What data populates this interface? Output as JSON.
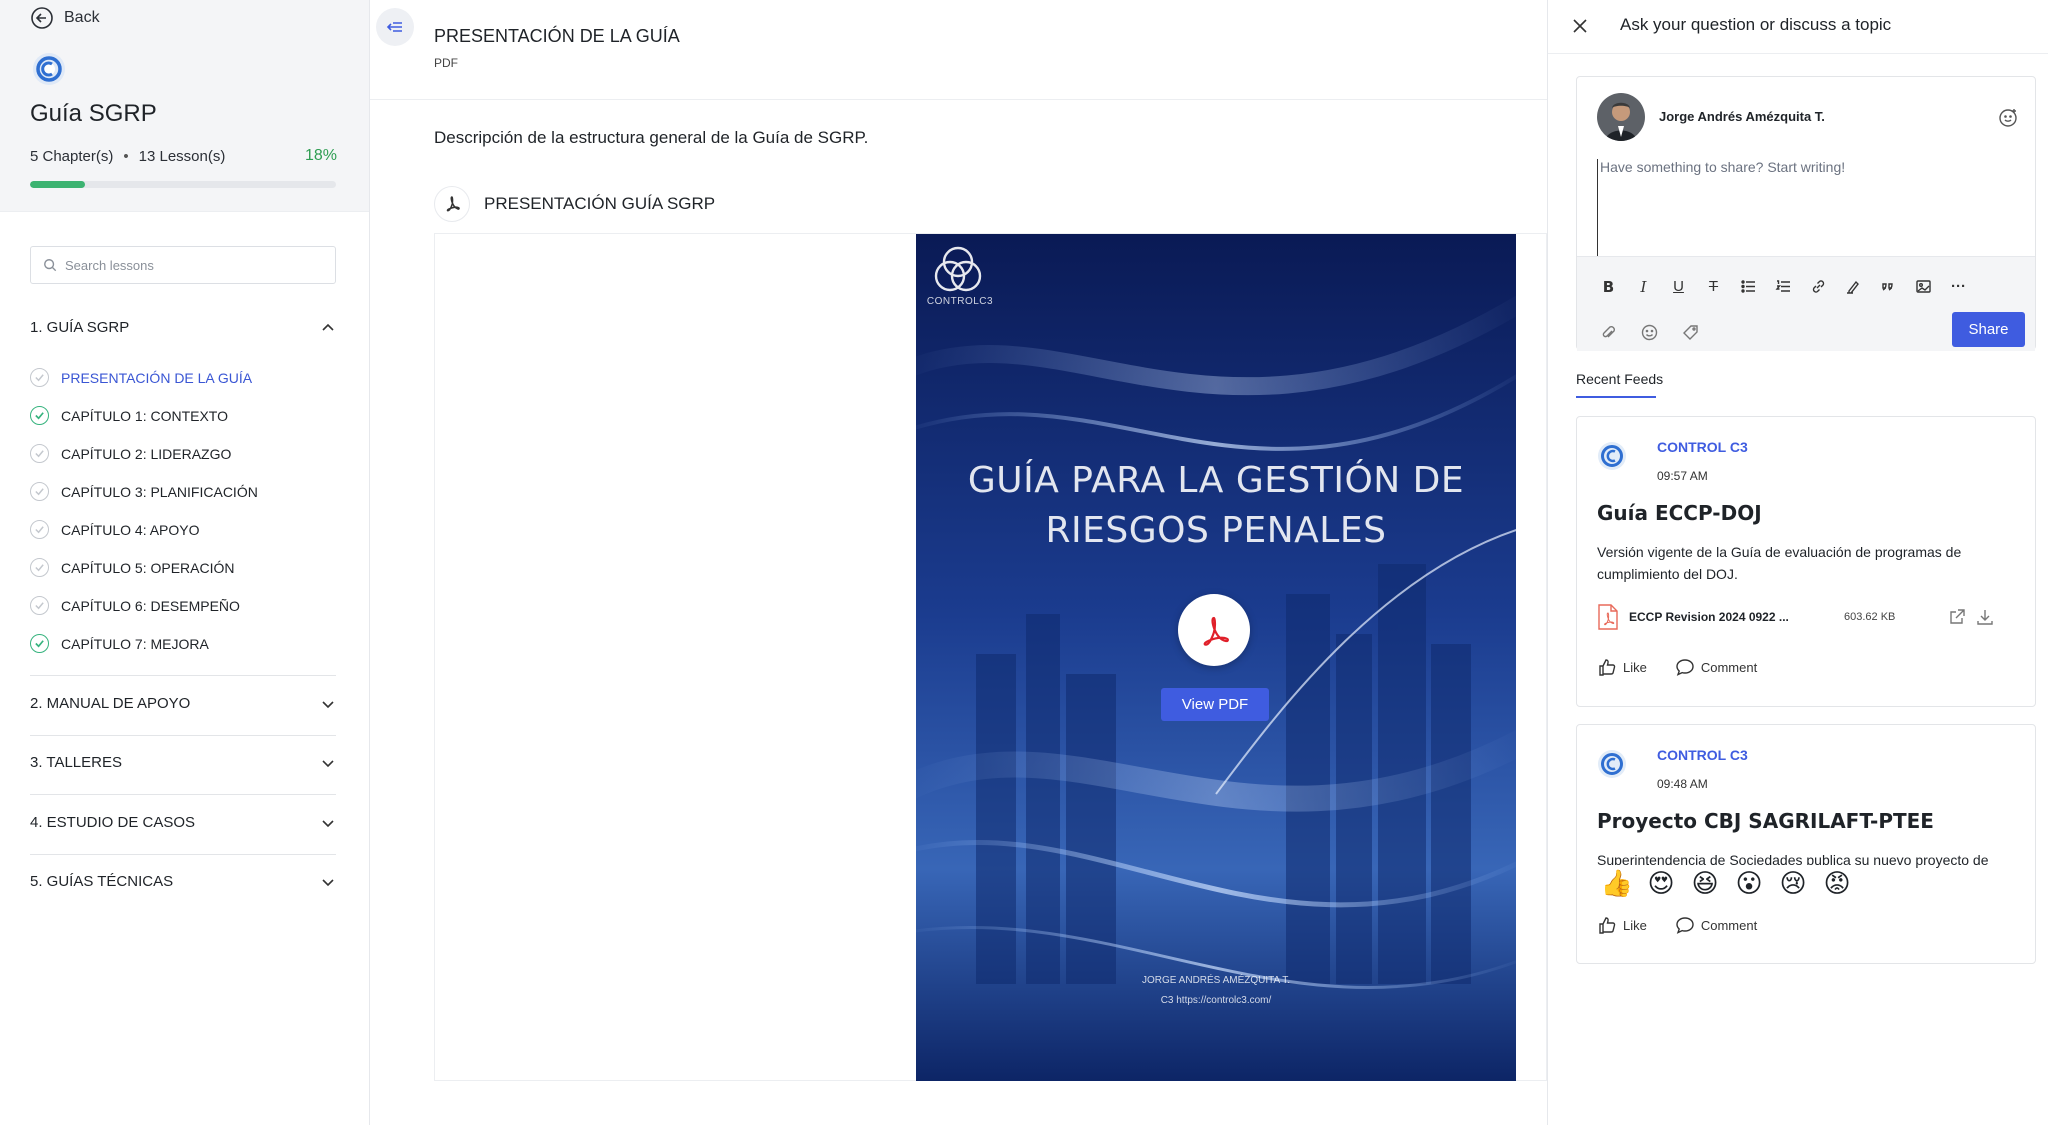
{
  "sidebar": {
    "back_label": "Back",
    "course_title": "Guía SGRP",
    "chapters_count": "5 Chapter(s)",
    "lessons_count": "13 Lesson(s)",
    "progress_percent_label": "18%",
    "progress_fraction": 0.18,
    "search_placeholder": "Search lessons",
    "chapters": [
      {
        "label": "1. GUÍA SGRP",
        "expanded": true
      },
      {
        "label": "2. MANUAL DE APOYO",
        "expanded": false
      },
      {
        "label": "3. TALLERES",
        "expanded": false
      },
      {
        "label": "4. ESTUDIO DE CASOS",
        "expanded": false
      },
      {
        "label": "5. GUÍAS TÉCNICAS",
        "expanded": false
      }
    ],
    "lessons": [
      {
        "label": "PRESENTACIÓN DE LA GUÍA",
        "done": false,
        "active": true
      },
      {
        "label": "CAPÍTULO 1: CONTEXTO",
        "done": true,
        "active": false
      },
      {
        "label": "CAPÍTULO 2: LIDERAZGO",
        "done": false,
        "active": false
      },
      {
        "label": "CAPÍTULO 3: PLANIFICACIÓN",
        "done": false,
        "active": false
      },
      {
        "label": "CAPÍTULO 4: APOYO",
        "done": false,
        "active": false
      },
      {
        "label": "CAPÍTULO 5: OPERACIÓN",
        "done": false,
        "active": false
      },
      {
        "label": "CAPÍTULO 6: DESEMPEÑO",
        "done": false,
        "active": false
      },
      {
        "label": "CAPÍTULO 7: MEJORA",
        "done": true,
        "active": false
      }
    ]
  },
  "main": {
    "lesson_title": "PRESENTACIÓN DE LA GUÍA",
    "lesson_type": "PDF",
    "description": "Descripción de la estructura general de la Guía de SGRP.",
    "attachment_name": "PRESENTACIÓN GUÍA SGRP",
    "cover": {
      "brand": "CONTROLC3",
      "title_line1": "GUÍA PARA LA GESTIÓN DE",
      "title_line2": "RIESGOS PENALES",
      "author": "JORGE ANDRÉS AMÉZQUITA T.",
      "url": "C3  https://controlc3.com/"
    },
    "view_pdf_label": "View PDF"
  },
  "panel": {
    "title": "Ask your question or discuss a topic",
    "composer": {
      "user_name": "Jorge Andrés Amézquita T.",
      "placeholder": "Have something to share? Start writing!",
      "share_label": "Share"
    },
    "feeds_tab": "Recent Feeds",
    "posts": [
      {
        "author": "CONTROL C3",
        "time": "09:57 AM",
        "title": "Guía ECCP-DOJ",
        "body": "Versión vigente de la Guía de evaluación de programas de cumplimiento del DOJ.",
        "file_name": "ECCP Revision 2024 0922 ...",
        "file_size": "603.62 KB",
        "like_label": "Like",
        "comment_label": "Comment"
      },
      {
        "author": "CONTROL C3",
        "time": "09:48 AM",
        "title": "Proyecto CBJ SAGRILAFT-PTEE",
        "body": "Superintendencia de Sociedades publica su nuevo proyecto de",
        "like_label": "Like",
        "comment_label": "Comment"
      }
    ],
    "reactions": [
      "👍",
      "😍",
      "😆",
      "😮",
      "😢",
      "😡"
    ]
  },
  "colors": {
    "accent": "#3f5ce0",
    "progress": "#3cb371",
    "done_check": "#36b37e"
  }
}
